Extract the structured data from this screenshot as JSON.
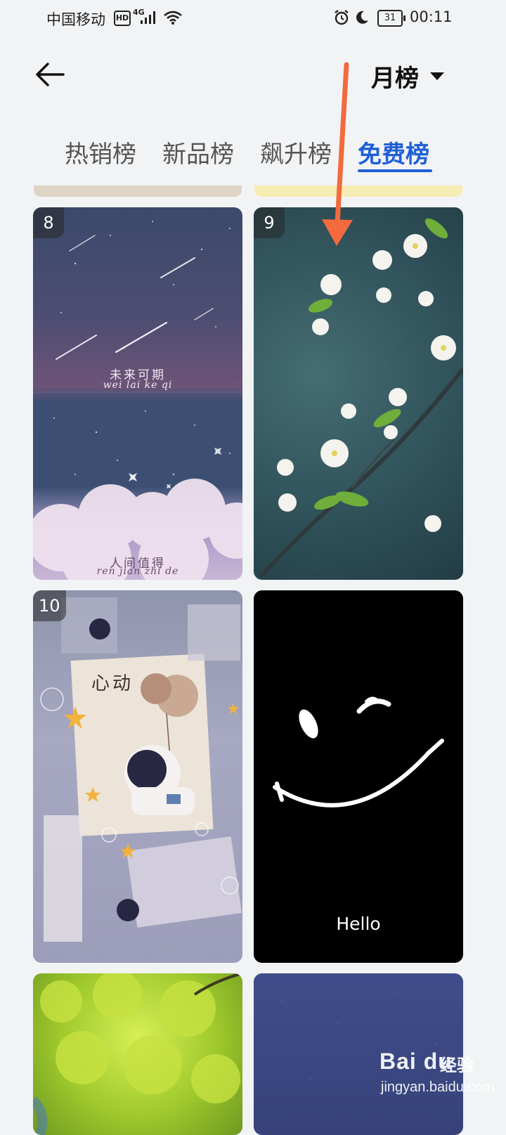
{
  "status_bar": {
    "carrier": "中国移动",
    "hd": "HD",
    "network": "4G",
    "battery": "31",
    "time": "00:11"
  },
  "header": {
    "period": "月榜",
    "back_icon": "arrow-left-icon",
    "dropdown_icon": "caret-down-icon"
  },
  "tabs": [
    {
      "label": "热销榜",
      "active": false
    },
    {
      "label": "新品榜",
      "active": false
    },
    {
      "label": "飙升榜",
      "active": false
    },
    {
      "label": "免费榜",
      "active": true
    }
  ],
  "accent_color": "#1f5fd6",
  "annotation_color": "#f26a3d",
  "wallpapers": [
    {
      "rank": "8",
      "caption_top_cn": "未来可期",
      "caption_top_py": "wei lai ke qi",
      "caption_bottom_cn": "人间值得",
      "caption_bottom_py": "ren jian zhi de"
    },
    {
      "rank": "9"
    },
    {
      "rank": "10",
      "heading": "心动"
    },
    {
      "rank": "",
      "text": "Hello"
    },
    {
      "rank": ""
    },
    {
      "rank": ""
    }
  ],
  "watermark": {
    "logo": "Bai du",
    "cn": "经验",
    "url": "jingyan.baidu.com"
  }
}
